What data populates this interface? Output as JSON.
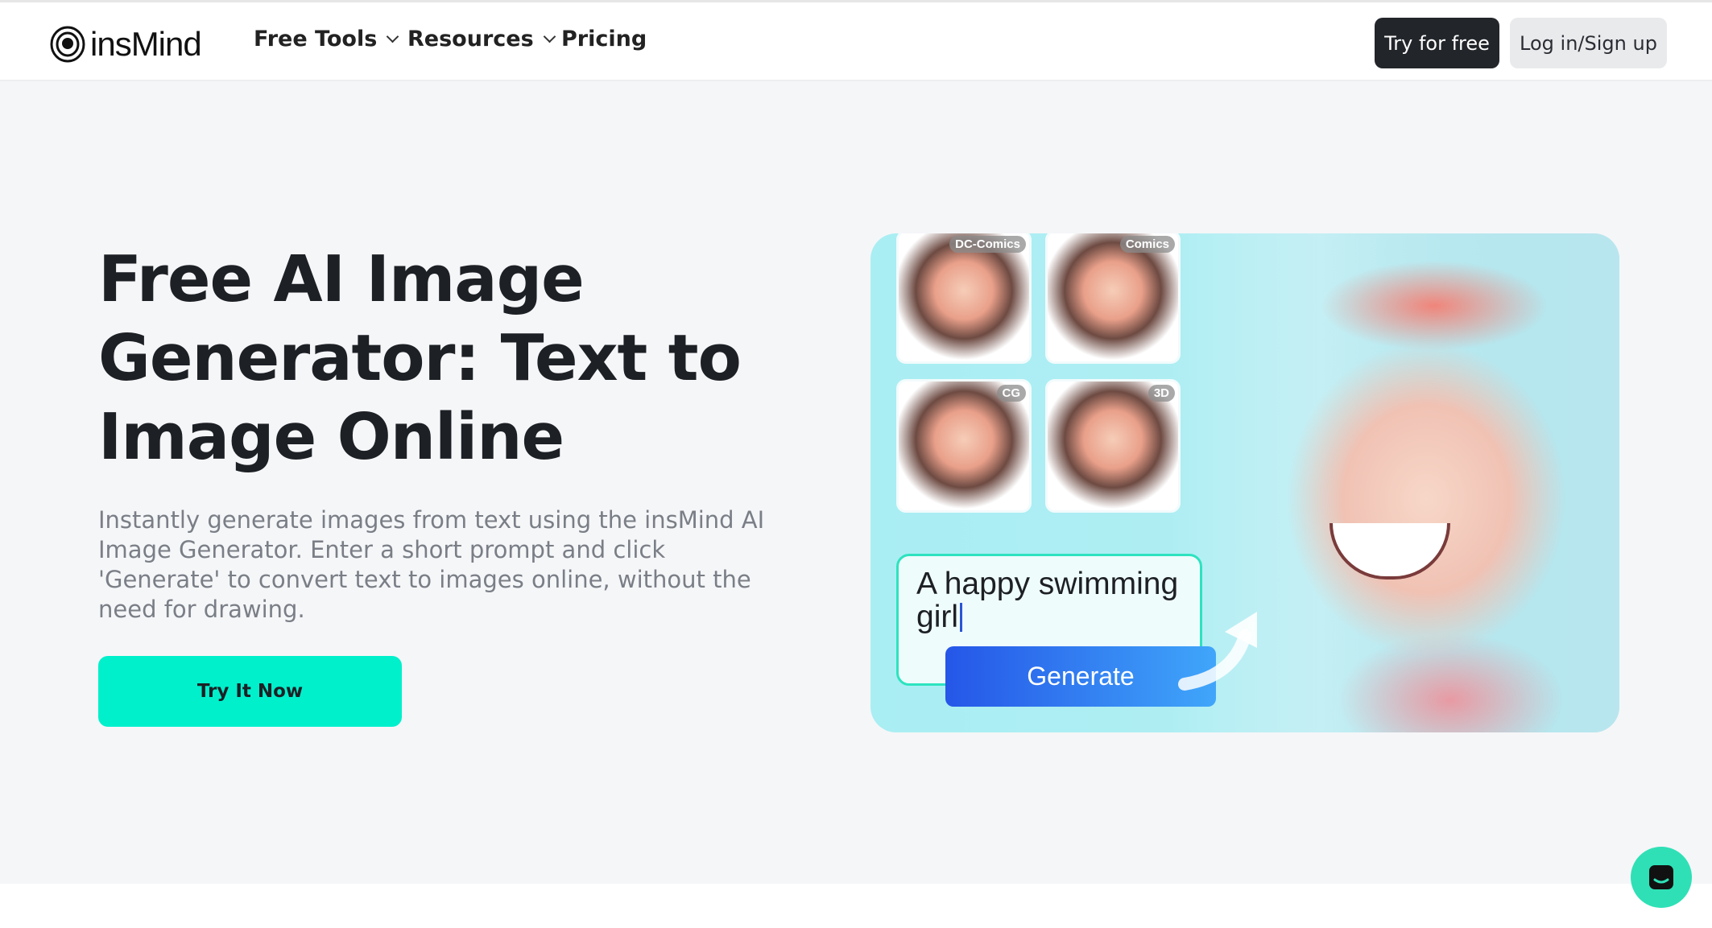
{
  "header": {
    "logo_text": "insMind",
    "nav": [
      {
        "label": "Free Tools",
        "has_dropdown": true
      },
      {
        "label": "Resources",
        "has_dropdown": true
      },
      {
        "label": "Pricing",
        "has_dropdown": false
      }
    ],
    "try_free_label": "Try for free",
    "login_label": "Log in/Sign up"
  },
  "hero": {
    "title": "Free AI Image Generator: Text to Image Online",
    "description": "Instantly generate images from text using the insMind AI Image Generator. Enter a short prompt and click 'Generate' to convert text to images online, without the need for drawing.",
    "cta_label": "Try It Now",
    "cta_color": "#00f0cc"
  },
  "showcase": {
    "styles": [
      "DC-Comics",
      "Comics",
      "CG",
      "3D"
    ],
    "prompt_text": "A happy swimming girl",
    "generate_label": "Generate"
  },
  "chat": {
    "icon": "chat-icon",
    "color": "#2fe0b6"
  }
}
